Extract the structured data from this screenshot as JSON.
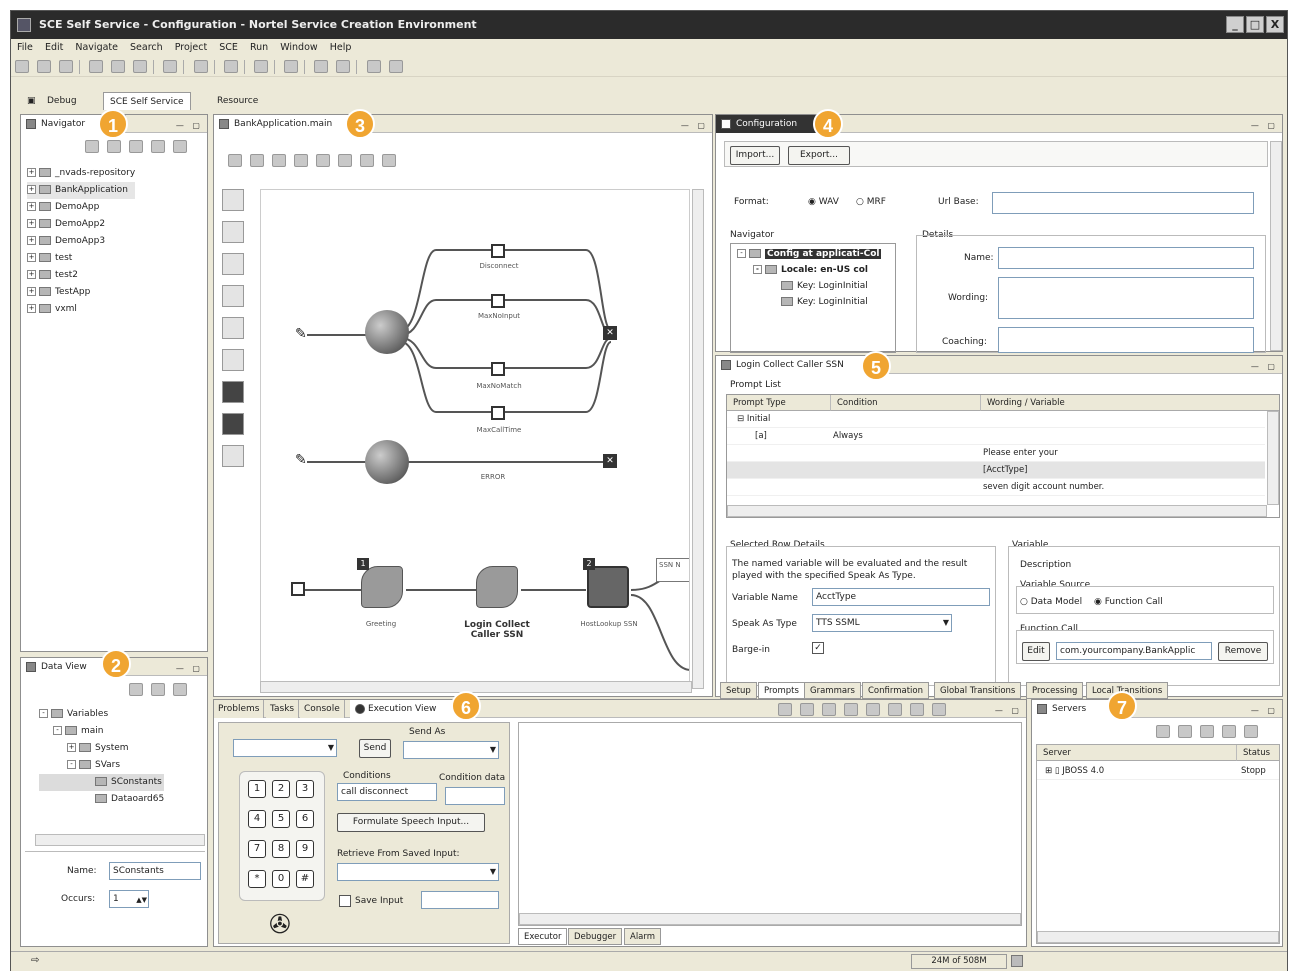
{
  "window": {
    "title": "SCE Self Service - Configuration - Nortel Service Creation Environment",
    "controls": [
      "_",
      "□",
      "X"
    ]
  },
  "menu": [
    "File",
    "Edit",
    "Navigate",
    "Search",
    "Project",
    "SCE",
    "Run",
    "Window",
    "Help"
  ],
  "perspectives": [
    {
      "label": "Debug",
      "active": false
    },
    {
      "label": "SCE Self Service",
      "active": true
    },
    {
      "label": "Resource",
      "active": false
    }
  ],
  "badges": [
    "1",
    "2",
    "3",
    "4",
    "5",
    "6",
    "7"
  ],
  "navigator": {
    "title": "Navigator",
    "items": [
      "_nvads-repository",
      "BankApplication",
      "DemoApp",
      "DemoApp2",
      "DemoApp3",
      "test",
      "test2",
      "TestApp",
      "vxml"
    ]
  },
  "dataview": {
    "title": "Data View",
    "tree": [
      "Variables",
      "main",
      "System",
      "SVars",
      "SConstants",
      "Dataoard65"
    ],
    "name_label": "Name:",
    "name_value": "SConstants",
    "occurs_label": "Occurs:",
    "occurs_value": "1"
  },
  "editor": {
    "title": "BankApplication.main",
    "nodes": [
      "Disconnect",
      "MaxNoInput",
      "MaxNoMatch",
      "MaxCallTime",
      "ERROR",
      "Greeting",
      "Login Collect Caller SSN",
      "HostLookup SSN",
      "SSN N"
    ],
    "step_labels": [
      "1",
      "2"
    ]
  },
  "configuration": {
    "title": "Configuration",
    "import_label": "Import...",
    "export_label": "Export...",
    "format_label": "Format:",
    "format_opts": [
      "WAV",
      "MRF"
    ],
    "urlbase_label": "Url Base:",
    "navigator_label": "Navigator",
    "details_label": "Details",
    "tree": [
      "Config at applicati-Col",
      "Locale: en-US col",
      "Key: LoginInitial",
      "Key: LoginInitial"
    ],
    "name_label": "Name:",
    "wording_label": "Wording:",
    "coaching_label": "Coaching:"
  },
  "prompt": {
    "title": "Login Collect Caller SSN",
    "prompt_list_label": "Prompt List",
    "columns": [
      "Prompt Type",
      "Condition",
      "Wording / Variable"
    ],
    "rows": [
      {
        "type": "Initial",
        "condition": "",
        "wording": ""
      },
      {
        "type": "[a]",
        "condition": "Always",
        "wording": ""
      },
      {
        "type": "",
        "condition": "",
        "wording": "Please enter your"
      },
      {
        "type": "",
        "condition": "",
        "wording": "[AcctType]"
      },
      {
        "type": "",
        "condition": "",
        "wording": "seven digit account number."
      }
    ],
    "selected_label": "Selected Row Details",
    "selected_desc": "The named variable will be evaluated and the result played with the specified Speak As Type.",
    "variable_name_label": "Variable Name",
    "variable_name_value": "AcctType",
    "speak_as_label": "Speak As Type",
    "speak_as_value": "TTS SSML",
    "bargein_label": "Barge-in",
    "variable_label": "Variable",
    "description_label": "Description",
    "variable_source_label": "Variable Source",
    "source_opts": [
      "Data Model",
      "Function Call"
    ],
    "function_call_label": "Function Call",
    "edit_label": "Edit",
    "function_value": "com.yourcompany.BankApplic",
    "remove_label": "Remove",
    "tabs": [
      "Setup",
      "Prompts",
      "Grammars",
      "Confirmation",
      "Global Transitions",
      "Processing",
      "Local Transitions"
    ]
  },
  "execution": {
    "tabs": [
      "Problems",
      "Tasks",
      "Console",
      "Execution View"
    ],
    "send_label": "Send",
    "send_as_label": "Send As",
    "conditions_label": "Conditions",
    "condition_data_label": "Condition data",
    "condition_value": "call disconnect",
    "formulate_label": "Formulate Speech Input...",
    "retrieve_label": "Retrieve From Saved Input:",
    "save_input_label": "Save Input",
    "keys": [
      "1",
      "2",
      "3",
      "4",
      "5",
      "6",
      "7",
      "8",
      "9",
      "*",
      "0",
      "#"
    ],
    "output_tabs": [
      "Executor",
      "Debugger",
      "Alarm"
    ]
  },
  "servers": {
    "title": "Servers",
    "columns": [
      "Server",
      "Status"
    ],
    "rows": [
      {
        "name": "JBOSS 4.0",
        "status": "Stopp"
      }
    ]
  },
  "status": {
    "memory": "24M of 508M"
  }
}
